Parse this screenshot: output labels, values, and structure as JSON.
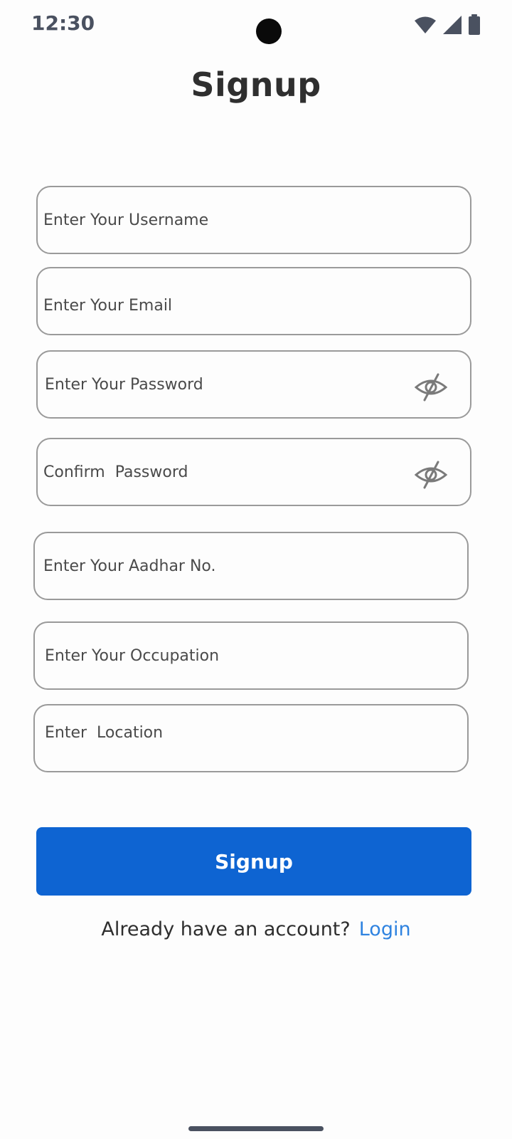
{
  "status_bar": {
    "time": "12:30",
    "icons": [
      "wifi-icon",
      "signal-icon",
      "battery-icon"
    ]
  },
  "page": {
    "title": "Signup"
  },
  "form": {
    "username": {
      "placeholder": "Enter Your Username",
      "value": ""
    },
    "email": {
      "placeholder": "Enter Your Email",
      "value": ""
    },
    "password": {
      "placeholder": "Enter Your Password",
      "value": "",
      "toggle_icon": "eye-off-icon"
    },
    "confirm_password": {
      "placeholder": "Confirm  Password",
      "value": "",
      "toggle_icon": "eye-off-icon"
    },
    "aadhar": {
      "placeholder": "Enter Your Aadhar No.",
      "value": ""
    },
    "occupation": {
      "placeholder": "Enter Your Occupation",
      "value": ""
    },
    "location": {
      "placeholder": "Enter  Location",
      "value": ""
    },
    "submit_label": "Signup"
  },
  "footer": {
    "prompt": "Already have an account?",
    "login_label": "Login"
  },
  "colors": {
    "primary_button": "#0e64d2",
    "link": "#2f83e0",
    "border": "#9a9a9a",
    "background": "#fdfdfd"
  }
}
